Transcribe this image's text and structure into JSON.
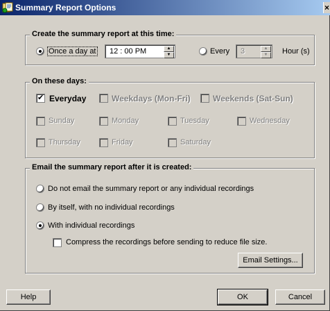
{
  "window": {
    "title": "Summary Report Options",
    "close_glyph": "×"
  },
  "schedule": {
    "legend": "Create the summary report at this time:",
    "once_label": "Once a day at",
    "once_selected": true,
    "time_value": "12 : 00  PM",
    "every_label": "Every",
    "every_selected": false,
    "every_value": "3",
    "hours_label": "Hour (s)"
  },
  "days": {
    "legend": "On these days:",
    "everyday": {
      "label": "Everyday",
      "checked": true
    },
    "weekdays": {
      "label": "Weekdays (Mon-Fri)",
      "checked": false
    },
    "weekends": {
      "label": "Weekends (Sat-Sun)",
      "checked": false
    },
    "individual": [
      "Sunday",
      "Monday",
      "Tuesday",
      "Wednesday",
      "Thursday",
      "Friday",
      "Saturday"
    ]
  },
  "email": {
    "legend": "Email the summary report after it is created:",
    "options": [
      {
        "label": "Do not email the summary report or any individual recordings",
        "selected": false
      },
      {
        "label": "By itself, with no individual recordings",
        "selected": false
      },
      {
        "label": "With individual recordings",
        "selected": true
      }
    ],
    "compress_label": "Compress the recordings before sending to reduce file size.",
    "compress_checked": false,
    "settings_button": "Email Settings..."
  },
  "footer": {
    "help": "Help",
    "ok": "OK",
    "cancel": "Cancel"
  },
  "icons": {
    "app": "report-icon"
  }
}
